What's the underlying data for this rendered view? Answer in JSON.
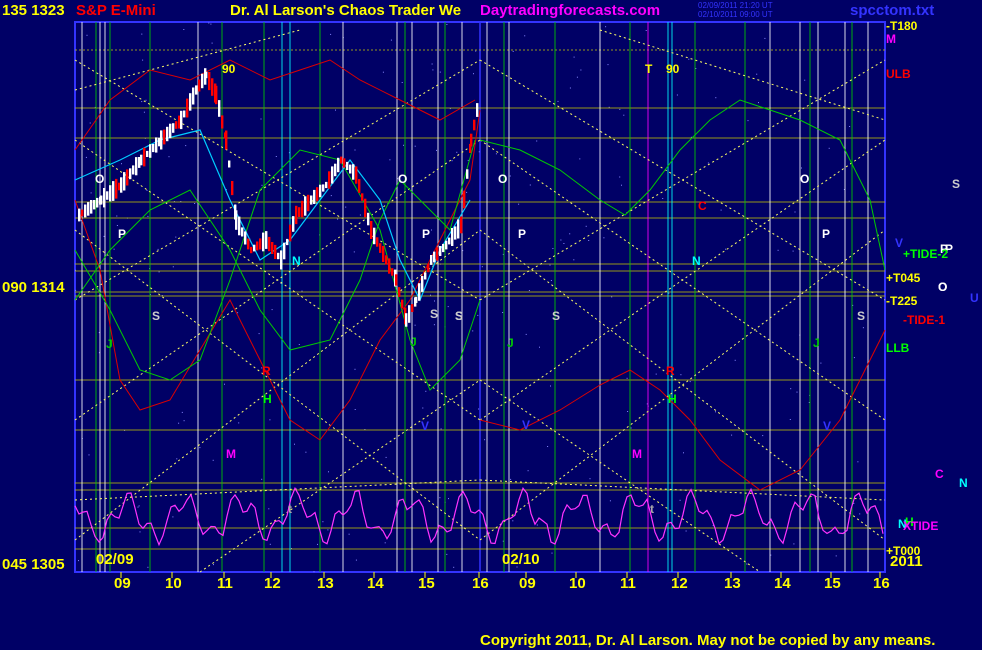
{
  "header": {
    "instrument": "S&P E-Mini",
    "price_top": "135  1323",
    "title": "Dr. Al Larson's Chaos Trader We",
    "site": "Daytradingforecasts.com",
    "timestamp_1": "02/09/2011 21:20 UT",
    "timestamp_2": "02/10/2011 09:00 UT",
    "file": "spcctom.txt"
  },
  "left_axis": {
    "mid": "090  1314",
    "bottom": "045  1305"
  },
  "date_labels": [
    "02/09",
    "02/10"
  ],
  "year_label": "2011",
  "footer": {
    "copyright": "Copyright 2011, Dr. Al Larson. May not be copied by any means."
  },
  "right_labels": [
    {
      "text": "-T180",
      "color": "#ffff00"
    },
    {
      "text": "M",
      "color": "#ff00ff"
    },
    {
      "text": "ULB",
      "color": "#ff0000"
    },
    {
      "text": "+TIDE-2",
      "color": "#00ff00"
    },
    {
      "text": "+T045",
      "color": "#ffff00"
    },
    {
      "text": "-T225",
      "color": "#ffff00"
    },
    {
      "text": "-TIDE-1",
      "color": "#ff0000"
    },
    {
      "text": "LLB",
      "color": "#00ff00"
    },
    {
      "text": "XTIDE",
      "color": "#ff00ff"
    },
    {
      "text": "+T000",
      "color": "#ffff00"
    }
  ],
  "planet_labels": [
    {
      "text": "90",
      "color": "#ffff00"
    },
    {
      "text": "T",
      "color": "#ffff00"
    },
    {
      "text": "90",
      "color": "#ffff00"
    },
    {
      "text": "O",
      "color": "#ffffff"
    },
    {
      "text": "O",
      "color": "#ffffff"
    },
    {
      "text": "O",
      "color": "#ffffff"
    },
    {
      "text": "O",
      "color": "#ffffff"
    },
    {
      "text": "O",
      "color": "#ffffff"
    },
    {
      "text": "P",
      "color": "#ffffff"
    },
    {
      "text": "P",
      "color": "#ffffff"
    },
    {
      "text": "P",
      "color": "#ffffff"
    },
    {
      "text": "P",
      "color": "#ffffff"
    },
    {
      "text": "P",
      "color": "#ffffff"
    },
    {
      "text": "S",
      "color": "#cccccc"
    },
    {
      "text": "S",
      "color": "#cccccc"
    },
    {
      "text": "S",
      "color": "#cccccc"
    },
    {
      "text": "S",
      "color": "#cccccc"
    },
    {
      "text": "S",
      "color": "#cccccc"
    },
    {
      "text": "S",
      "color": "#cccccc"
    },
    {
      "text": "N",
      "color": "#00ffff"
    },
    {
      "text": "N",
      "color": "#00ffff"
    },
    {
      "text": "N",
      "color": "#00ffff"
    },
    {
      "text": "J",
      "color": "#00cc00"
    },
    {
      "text": "J",
      "color": "#00cc00"
    },
    {
      "text": "J",
      "color": "#00cc00"
    },
    {
      "text": "J",
      "color": "#00cc00"
    },
    {
      "text": "H",
      "color": "#00ff00"
    },
    {
      "text": "H",
      "color": "#00ff00"
    },
    {
      "text": "H",
      "color": "#00ff00"
    },
    {
      "text": "M",
      "color": "#ff00ff"
    },
    {
      "text": "M",
      "color": "#ff00ff"
    },
    {
      "text": "R",
      "color": "#ff0000"
    },
    {
      "text": "R",
      "color": "#ff0000"
    },
    {
      "text": "C",
      "color": "#ff0000"
    },
    {
      "text": "C",
      "color": "#ff00ff"
    },
    {
      "text": "N",
      "color": "#00ffff"
    },
    {
      "text": "V",
      "color": "#3333ff"
    },
    {
      "text": "V",
      "color": "#3333ff"
    },
    {
      "text": "V",
      "color": "#3333ff"
    },
    {
      "text": "V",
      "color": "#3333ff"
    },
    {
      "text": "U",
      "color": "#3333ff"
    },
    {
      "text": "t",
      "color": "#aaaaaa"
    },
    {
      "text": "t",
      "color": "#aaaaaa"
    },
    {
      "text": "P",
      "color": "#ffffff"
    },
    {
      "text": "O",
      "color": "#ffffff"
    },
    {
      "text": "S",
      "color": "#cccccc"
    }
  ],
  "colors": {
    "background": "#000066",
    "frame": "#3333ff",
    "grid_h": "#c8c800",
    "grid_v": "#00cc00",
    "up_bar": "#ffffff",
    "down_bar": "#ff0000",
    "cyan_line": "#00ccff",
    "oscillator": "#ff33ff",
    "red_curve": "#dd0000",
    "green_curve": "#00cc00"
  },
  "chart_data": {
    "type": "line",
    "title": "S&P E-Mini",
    "xlabel": "",
    "ylabel": "",
    "x_tick_labels": [
      "09",
      "10",
      "11",
      "12",
      "13",
      "14",
      "15",
      "16",
      "09",
      "10",
      "11",
      "12",
      "13",
      "14",
      "15",
      "16"
    ],
    "y_tick_labels": [
      "1323",
      "1314",
      "1305"
    ],
    "ylim": [
      1305,
      1323
    ],
    "grid": true,
    "series": []
  }
}
